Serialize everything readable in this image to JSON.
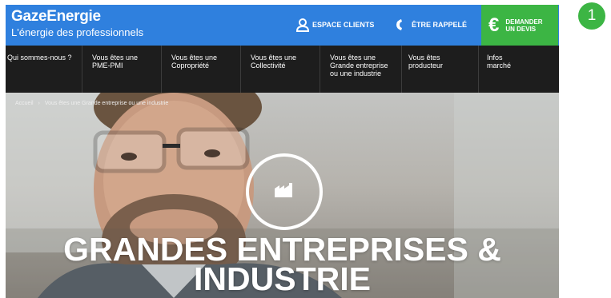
{
  "brand": {
    "name": "GazeEnergie",
    "tagline": "L'énergie des professionnels"
  },
  "header": {
    "espace_clients": "ESPACE CLIENTS",
    "etre_rappele": "ÊTRE RAPPELÉ",
    "devis_line1": "DEMANDER",
    "devis_line2": "UN DEVIS",
    "devis_symbol": "€"
  },
  "nav": {
    "items": [
      {
        "line1": "Qui sommes-nous ?",
        "line2": "",
        "line3": ""
      },
      {
        "line1": "Vous êtes une",
        "line2": "PME-PMI",
        "line3": ""
      },
      {
        "line1": "Vous êtes une",
        "line2": "Copropriété",
        "line3": ""
      },
      {
        "line1": "Vous êtes une",
        "line2": "Collectivité",
        "line3": ""
      },
      {
        "line1": "Vous êtes une",
        "line2": "Grande entreprise",
        "line3": "ou une industrie"
      },
      {
        "line1": "Vous êtes",
        "line2": "producteur",
        "line3": ""
      },
      {
        "line1": "Infos",
        "line2": "marché",
        "line3": ""
      }
    ]
  },
  "breadcrumb": {
    "home": "Accueil",
    "separator": "›",
    "current": "Vous êtes une Grande entreprise ou une industrie"
  },
  "hero": {
    "title_line1": "GRANDES ENTREPRISES &",
    "title_line2": "INDUSTRIE",
    "icon": "factory-icon"
  },
  "badge": {
    "number": "1"
  },
  "colors": {
    "header_blue": "#2f80de",
    "nav_dark": "#1d1d1d",
    "cta_green": "#3cb544"
  }
}
